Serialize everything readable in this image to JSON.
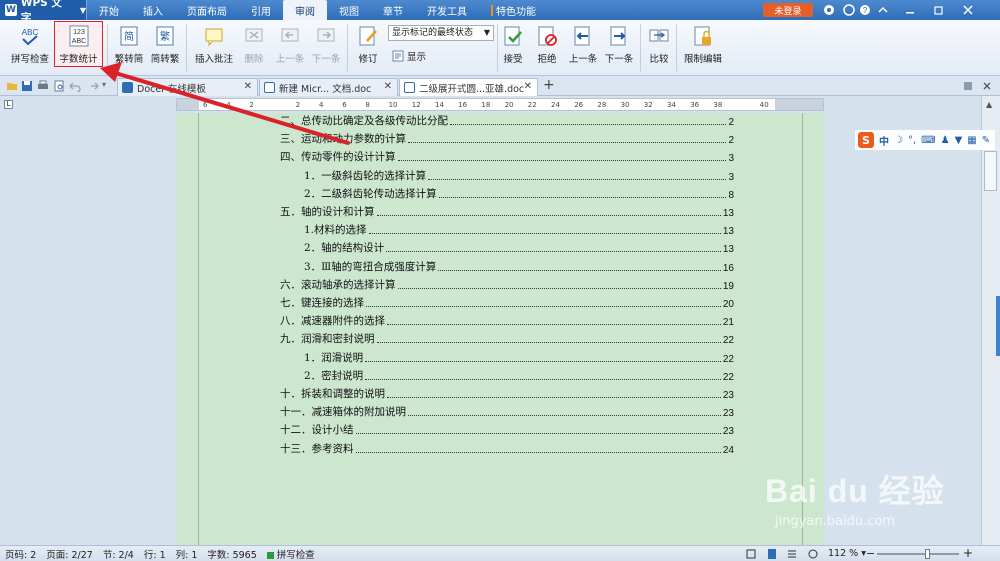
{
  "app": {
    "name": "WPS 文字",
    "logo_letter": "W"
  },
  "menu": {
    "tabs": [
      "开始",
      "插入",
      "页面布局",
      "引用",
      "审阅",
      "视图",
      "章节",
      "开发工具"
    ],
    "special": "特色功能",
    "active": "审阅"
  },
  "login": "未登录",
  "ribbon": {
    "spell_check": "拼写检查",
    "word_count": "字数统计",
    "to_traditional": "繁转简",
    "to_simplified": "简转繁",
    "insert_comment": "插入批注",
    "delete": "删除",
    "prev_comment": "上一条",
    "next_comment": "下一条",
    "revisions": "修订",
    "display_mode": "显示标记的最终状态",
    "display": "显示",
    "accept": "接受",
    "reject": "拒绝",
    "prev": "上一条",
    "next": "下一条",
    "compare": "比较",
    "restrict": "限制编辑",
    "wc_icon_top": "123",
    "wc_icon_bottom": "ABC",
    "spell_icon": "ABC",
    "trad_icon": "简",
    "simp_icon": "繁"
  },
  "tabs": [
    {
      "title": "Docer-在线模板",
      "icon": "docer"
    },
    {
      "title": "新建 Micr... 文档.doc",
      "icon": "doc"
    },
    {
      "title": "二级展开式圆...亚雄.doc",
      "icon": "doc",
      "active": true
    }
  ],
  "ruler_ticks": [
    "6",
    "4",
    "2",
    "",
    "2",
    "4",
    "6",
    "8",
    "10",
    "12",
    "14",
    "16",
    "18",
    "20",
    "22",
    "24",
    "26",
    "28",
    "30",
    "32",
    "34",
    "36",
    "38",
    "",
    "40"
  ],
  "toc": [
    {
      "title": "二、总传动比确定及各级传动比分配",
      "page": "2",
      "indent": 0
    },
    {
      "title": "三、运动和动力参数的计算",
      "page": "2",
      "indent": 0
    },
    {
      "title": "四、传动零件的设计计算",
      "page": "3",
      "indent": 0
    },
    {
      "title": "1．一级斜齿轮的选择计算",
      "page": "3",
      "indent": 1
    },
    {
      "title": "2．二级斜齿轮传动选择计算",
      "page": "8",
      "indent": 1
    },
    {
      "title": "五．轴的设计和计算",
      "page": "13",
      "indent": 0
    },
    {
      "title": "1.材料的选择",
      "page": "13",
      "indent": 1
    },
    {
      "title": "2．轴的结构设计",
      "page": "13",
      "indent": 1
    },
    {
      "title": "3．Ⅲ轴的弯扭合成强度计算",
      "page": "16",
      "indent": 1
    },
    {
      "title": "六．滚动轴承的选择计算",
      "page": "19",
      "indent": 0
    },
    {
      "title": "七．键连接的选择",
      "page": "20",
      "indent": 0
    },
    {
      "title": "八．减速器附件的选择",
      "page": "21",
      "indent": 0
    },
    {
      "title": "九．润滑和密封说明",
      "page": "22",
      "indent": 0
    },
    {
      "title": "1．润滑说明",
      "page": "22",
      "indent": 1
    },
    {
      "title": "2．密封说明",
      "page": "22",
      "indent": 1
    },
    {
      "title": "十．拆装和调整的说明",
      "page": "23",
      "indent": 0
    },
    {
      "title": "十一．减速箱体的附加说明",
      "page": "23",
      "indent": 0
    },
    {
      "title": "十二．设计小结",
      "page": "23",
      "indent": 0
    },
    {
      "title": "十三．参考资料",
      "page": "24",
      "indent": 0
    }
  ],
  "ime": {
    "logo": "S",
    "lang": "中"
  },
  "status": {
    "page_no": "页码: 2",
    "pages": "页面: 2/27",
    "section": "节: 2/4",
    "row": "行: 1",
    "col": "列: 1",
    "word_count": "字数: 5965",
    "spell": "拼写检查",
    "zoom": "112 %",
    "zoom_level": 0.62
  },
  "watermark": {
    "logo": "Bai du 经验",
    "url": "jingyan.baidu.com"
  },
  "colors": {
    "accent": "#2e6cb6",
    "login": "#e4602b",
    "highlight": "#d9222a",
    "page_bg": "#cde7cf"
  }
}
